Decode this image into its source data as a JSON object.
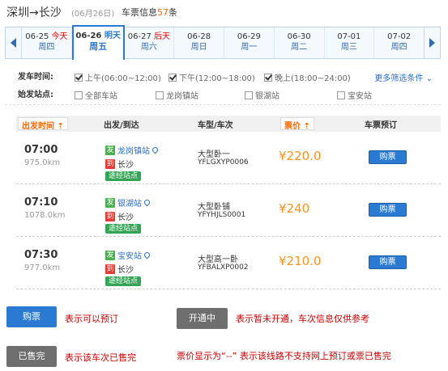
{
  "header": {
    "route": "深圳→长沙",
    "date": "(06月26日)",
    "info_prefix": "车票信息",
    "info_count": "57",
    "info_suffix": "条"
  },
  "dates": [
    {
      "date": "06-25",
      "tag": "今天",
      "weekday": "周四",
      "active": false
    },
    {
      "date": "06-26",
      "tag": "明天",
      "weekday": "周五",
      "active": true
    },
    {
      "date": "06-27",
      "tag": "后天",
      "weekday": "周六",
      "active": false
    },
    {
      "date": "06-28",
      "tag": "",
      "weekday": "周日",
      "active": false
    },
    {
      "date": "06-29",
      "tag": "",
      "weekday": "周一",
      "active": false
    },
    {
      "date": "06-30",
      "tag": "",
      "weekday": "周二",
      "active": false
    },
    {
      "date": "07-01",
      "tag": "",
      "weekday": "周三",
      "active": false
    },
    {
      "date": "07-02",
      "tag": "",
      "weekday": "周四",
      "active": false
    }
  ],
  "filters": {
    "time_label": "发车时间:",
    "time_options": [
      {
        "label": "上午(06:00~12:00)",
        "checked": true
      },
      {
        "label": "下午(12:00~18:00)",
        "checked": true
      },
      {
        "label": "晚上(18:00~24:00)",
        "checked": true
      }
    ],
    "more": "更多筛选条件",
    "station_label": "始发站点:",
    "station_options": [
      {
        "label": "全部车站",
        "checked": false
      },
      {
        "label": "龙岗镇站",
        "checked": false
      },
      {
        "label": "银湖站",
        "checked": false
      },
      {
        "label": "宝安站",
        "checked": false
      }
    ]
  },
  "table_header": {
    "depart_time": "出发时间",
    "from_to": "出发/到达",
    "type_code": "车型/车次",
    "price": "票价",
    "booking": "车票预订"
  },
  "rows": [
    {
      "time": "07:00",
      "km": "975.0km",
      "from": "龙岗镇站",
      "to": "长沙",
      "via": "途经站点",
      "type": "大型卧一",
      "code": "YFLGXYP0006",
      "price": "¥220.0",
      "buy": "购票"
    },
    {
      "time": "07:10",
      "km": "1078.0km",
      "from": "银湖站",
      "to": "长沙",
      "via": "途经站点",
      "type": "大型卧铺",
      "code": "YFYHJLS0001",
      "price": "¥240",
      "buy": "购票"
    },
    {
      "time": "07:30",
      "km": "977.0km",
      "from": "宝安站",
      "to": "长沙",
      "via": "途经站点",
      "type": "大型高一卧",
      "code": "YFBALXP0002",
      "price": "¥210.0",
      "buy": "购票"
    }
  ],
  "badges": {
    "from": "发",
    "to": "到"
  },
  "legend": {
    "buy_label": "购票",
    "buy_text": "表示可以预订",
    "open_label": "开通中",
    "open_text": "表示暂未开通，车次信息仅供参考",
    "sold_label": "已售完",
    "sold_text": "表示该车次已售完",
    "price_note": "票价显示为“--”  表示该线路不支持网上预订或票已售完"
  },
  "colors": {
    "accent": "#2a7ad2",
    "price": "#f7931e",
    "warning": "#cc0000"
  }
}
